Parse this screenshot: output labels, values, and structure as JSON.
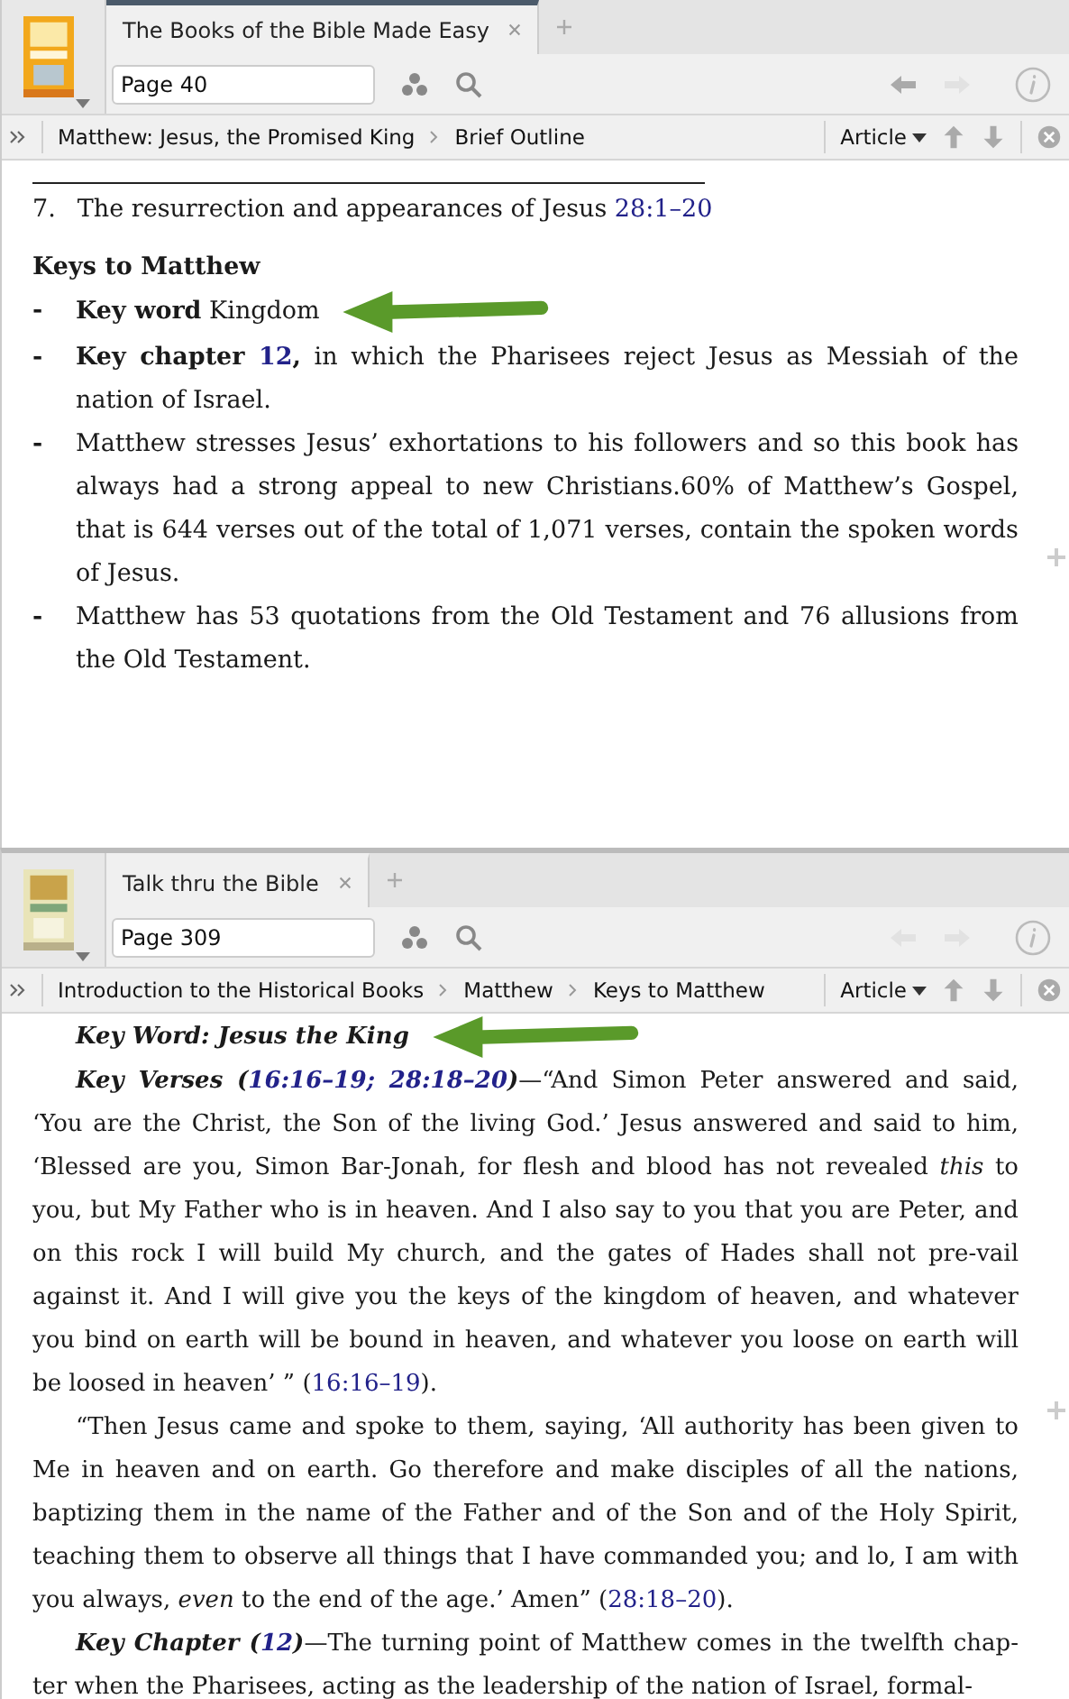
{
  "panels": [
    {
      "active": true,
      "tab": {
        "title": "The Books of the Bible Made Easy",
        "selected": true
      },
      "page_field": {
        "value": "Page 40"
      },
      "nav": {
        "back_enabled": true,
        "forward_enabled": false
      },
      "breadcrumb": [
        "Matthew: Jesus, the Promised King",
        "Brief Outline"
      ],
      "view_menu": "Article",
      "content": [
        {
          "kind": "rule"
        },
        {
          "kind": "outline",
          "number": "7.",
          "segments": [
            {
              "kind": "plain",
              "text": "The resurrection and appearances of Jesus "
            },
            {
              "kind": "link",
              "text": "28:1–20"
            }
          ]
        },
        {
          "kind": "heading",
          "segments": [
            {
              "kind": "bold",
              "text": "Keys to Matthew"
            }
          ]
        },
        {
          "kind": "bullet",
          "marker": "-",
          "pointed": true,
          "segments": [
            {
              "kind": "bold",
              "text": "Key word"
            },
            {
              "kind": "plain",
              "text": " Kingdom"
            }
          ]
        },
        {
          "kind": "bullet",
          "marker": "-",
          "segments": [
            {
              "kind": "bold",
              "text": "Key chapter "
            },
            {
              "kind": "boldlink",
              "text": "12"
            },
            {
              "kind": "bold",
              "text": ","
            },
            {
              "kind": "plain",
              "text": " in which the Pharisees reject Jesus as Messiah of the nation of Israel."
            }
          ]
        },
        {
          "kind": "bullet",
          "marker": "-",
          "segments": [
            {
              "kind": "plain",
              "text": "Matthew stresses Jesus’ exhortations to his followers and so this book has always had a strong appeal to new Christians.60% of Matthew’s Gospel, that is 644 verses out of the total of 1,071 verses, contain the spoken words of Jesus."
            }
          ]
        },
        {
          "kind": "bullet",
          "marker": "-",
          "segments": [
            {
              "kind": "plain",
              "text": "Matthew has 53 quotations from the Old Testament and 76 allusions from the Old Testament."
            }
          ]
        }
      ]
    },
    {
      "active": false,
      "tab": {
        "title": "Talk thru the Bible",
        "selected": true
      },
      "page_field": {
        "value": "Page 309"
      },
      "nav": {
        "back_enabled": false,
        "forward_enabled": false
      },
      "breadcrumb": [
        "Introduction to the Historical Books",
        "Matthew",
        "Keys to Matthew"
      ],
      "view_menu": "Article",
      "content": [
        {
          "kind": "para",
          "pointed": true,
          "segments": [
            {
              "kind": "bolditalic",
              "text": "Key Word: Jesus the King"
            }
          ]
        },
        {
          "kind": "para",
          "segments": [
            {
              "kind": "bolditalic",
              "text": "Key Verses ("
            },
            {
              "kind": "bolditaliclink",
              "text": "16:16–19; 28:18–20"
            },
            {
              "kind": "bolditalic",
              "text": ")"
            },
            {
              "kind": "plain",
              "text": "—“And Simon Peter answered and said, ‘You are the Christ, the Son of the living God.’ Jesus answered and said to him, ‘Blessed are you, Simon Bar-Jonah, for flesh and blood has not revealed "
            },
            {
              "kind": "italic",
              "text": "this"
            },
            {
              "kind": "plain",
              "text": " to you, but My Father who is in heaven. And I also say to you that you are Peter, and on this rock I will build My church, and the gates of Hades shall not pre-vail against it. And I will give you the keys of the kingdom of heaven, and whatever you bind on earth will be bound in heaven, and whatever you loose on earth will be loosed in heaven’ ” ("
            },
            {
              "kind": "link",
              "text": "16:16–19"
            },
            {
              "kind": "plain",
              "text": ")."
            }
          ]
        },
        {
          "kind": "para",
          "segments": [
            {
              "kind": "plain",
              "text": "“Then Jesus came and spoke to them, saying, ‘All authority has been given to Me in heaven and on earth. Go therefore and make disciples of all the nations, baptizing them in the name of the Father and of the Son and of the Holy Spirit, teaching them to observe all things that I have commanded you; and lo, I am with you always, "
            },
            {
              "kind": "italic",
              "text": "even"
            },
            {
              "kind": "plain",
              "text": " to the end of the age.’ Amen” ("
            },
            {
              "kind": "link",
              "text": "28:18–20"
            },
            {
              "kind": "plain",
              "text": ")."
            }
          ]
        },
        {
          "kind": "para",
          "segments": [
            {
              "kind": "bolditalic",
              "text": "Key Chapter ("
            },
            {
              "kind": "bolditaliclink",
              "text": "12"
            },
            {
              "kind": "bolditalic",
              "text": ")"
            },
            {
              "kind": "plain",
              "text": "—The turning point of Matthew comes in the twelfth chap-ter when the Pharisees, acting as the leadership of the nation of Israel, formal-"
            }
          ]
        }
      ]
    }
  ]
}
